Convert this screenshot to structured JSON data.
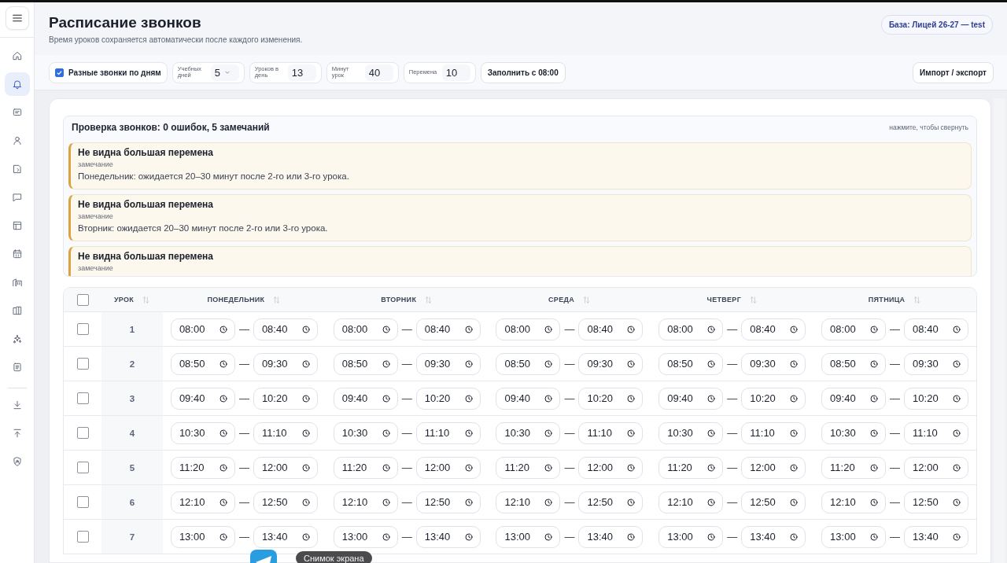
{
  "sidebar": {
    "items": [
      {
        "selected": false
      },
      {
        "selected": true
      },
      {
        "selected": false
      },
      {
        "selected": false
      },
      {
        "selected": false
      },
      {
        "selected": false
      },
      {
        "selected": false
      },
      {
        "selected": false
      },
      {
        "selected": false
      },
      {
        "selected": false
      },
      {
        "selected": false
      },
      {
        "selected": false
      }
    ]
  },
  "header": {
    "title": "Расписание звонков",
    "subtitle": "Время уроков сохраняется автоматически после каждого изменения.",
    "base_badge": "База: Лицей 26-27 — test"
  },
  "toolbar": {
    "checkbox": {
      "label": "Разные звонки по дням",
      "checked": true
    },
    "fields": [
      {
        "kind": "select",
        "label": "Учебных дней",
        "value": "5"
      },
      {
        "kind": "number",
        "label": "Уроков в день",
        "value": "13"
      },
      {
        "kind": "number",
        "label": "Минут урок",
        "value": "40"
      },
      {
        "kind": "number",
        "label": "Перемена",
        "value": "10"
      }
    ],
    "fill_button": "Заполнить с 08:00",
    "import_button": "Импорт / экспорт"
  },
  "check_panel": {
    "title": "Проверка звонков: 0 ошибок, 5 замечаний",
    "hint": "нажмите, чтобы свернуть",
    "alerts": [
      {
        "title": "Не видна большая перемена",
        "level": "замечание",
        "text": "Понедельник: ожидается 20–30 минут после 2-го или 3-го урока."
      },
      {
        "title": "Не видна большая перемена",
        "level": "замечание",
        "text": "Вторник: ожидается 20–30 минут после 2-го или 3-го урока."
      },
      {
        "title": "Не видна большая перемена",
        "level": "замечание"
      }
    ]
  },
  "table": {
    "all_checked": false,
    "separator": "—",
    "columns": [
      "УРОК",
      "ПОНЕДЕЛЬНИК",
      "ВТОРНИК",
      "СРЕДА",
      "ЧЕТВЕРГ",
      "ПЯТНИЦА"
    ],
    "rows": [
      {
        "checked": false,
        "lesson": "1",
        "times": [
          [
            "08:00",
            "08:40"
          ],
          [
            "08:00",
            "08:40"
          ],
          [
            "08:00",
            "08:40"
          ],
          [
            "08:00",
            "08:40"
          ],
          [
            "08:00",
            "08:40"
          ]
        ]
      },
      {
        "checked": false,
        "lesson": "2",
        "times": [
          [
            "08:50",
            "09:30"
          ],
          [
            "08:50",
            "09:30"
          ],
          [
            "08:50",
            "09:30"
          ],
          [
            "08:50",
            "09:30"
          ],
          [
            "08:50",
            "09:30"
          ]
        ]
      },
      {
        "checked": false,
        "lesson": "3",
        "times": [
          [
            "09:40",
            "10:20"
          ],
          [
            "09:40",
            "10:20"
          ],
          [
            "09:40",
            "10:20"
          ],
          [
            "09:40",
            "10:20"
          ],
          [
            "09:40",
            "10:20"
          ]
        ]
      },
      {
        "checked": false,
        "lesson": "4",
        "times": [
          [
            "10:30",
            "11:10"
          ],
          [
            "10:30",
            "11:10"
          ],
          [
            "10:30",
            "11:10"
          ],
          [
            "10:30",
            "11:10"
          ],
          [
            "10:30",
            "11:10"
          ]
        ]
      },
      {
        "checked": false,
        "lesson": "5",
        "times": [
          [
            "11:20",
            "12:00"
          ],
          [
            "11:20",
            "12:00"
          ],
          [
            "11:20",
            "12:00"
          ],
          [
            "11:20",
            "12:00"
          ],
          [
            "11:20",
            "12:00"
          ]
        ]
      },
      {
        "checked": false,
        "lesson": "6",
        "times": [
          [
            "12:10",
            "12:50"
          ],
          [
            "12:10",
            "12:50"
          ],
          [
            "12:10",
            "12:50"
          ],
          [
            "12:10",
            "12:50"
          ],
          [
            "12:10",
            "12:50"
          ]
        ]
      },
      {
        "checked": false,
        "lesson": "7",
        "times": [
          [
            "13:00",
            "13:40"
          ],
          [
            "13:00",
            "13:40"
          ],
          [
            "13:00",
            "13:40"
          ],
          [
            "13:00",
            "13:40"
          ],
          [
            "13:00",
            "13:40"
          ]
        ]
      }
    ]
  },
  "overlay": {
    "tooltip": "Снимок экрана"
  }
}
